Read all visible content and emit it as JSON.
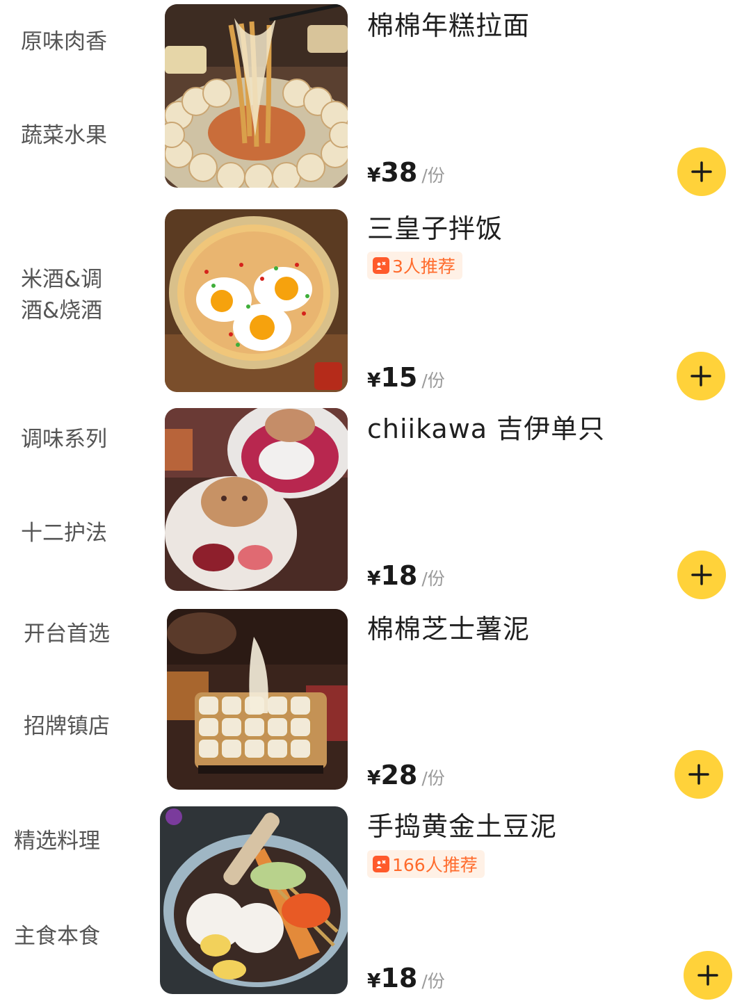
{
  "categories": [
    {
      "label": "原味肉香"
    },
    {
      "label": "蔬菜水果"
    },
    {
      "label": "米酒&调\n酒&烧酒"
    },
    {
      "label": "调味系列"
    },
    {
      "label": "十二护法"
    },
    {
      "label": "开台首选"
    },
    {
      "label": "招牌镇店"
    },
    {
      "label": "精选料理"
    },
    {
      "label": "主食本食"
    }
  ],
  "dishes": [
    {
      "name": "棉棉年糕拉面",
      "currency": "¥",
      "price": "38",
      "unit": "/份",
      "recommend": null
    },
    {
      "name": "三皇子拌饭",
      "currency": "¥",
      "price": "15",
      "unit": "/份",
      "recommend": "3人推荐"
    },
    {
      "name": "chiikawa 吉伊单只",
      "currency": "¥",
      "price": "18",
      "unit": "/份",
      "recommend": null
    },
    {
      "name": "棉棉芝士薯泥",
      "currency": "¥",
      "price": "28",
      "unit": "/份",
      "recommend": null
    },
    {
      "name": "手捣黄金土豆泥",
      "currency": "¥",
      "price": "18",
      "unit": "/份",
      "recommend": "166人推荐"
    }
  ],
  "colors": {
    "accent": "#ffd23a",
    "recommend_text": "#ff6b2c",
    "recommend_bg": "#fff1e6"
  },
  "icons": {
    "add": "plus-icon",
    "recommend": "recommend-icon"
  }
}
